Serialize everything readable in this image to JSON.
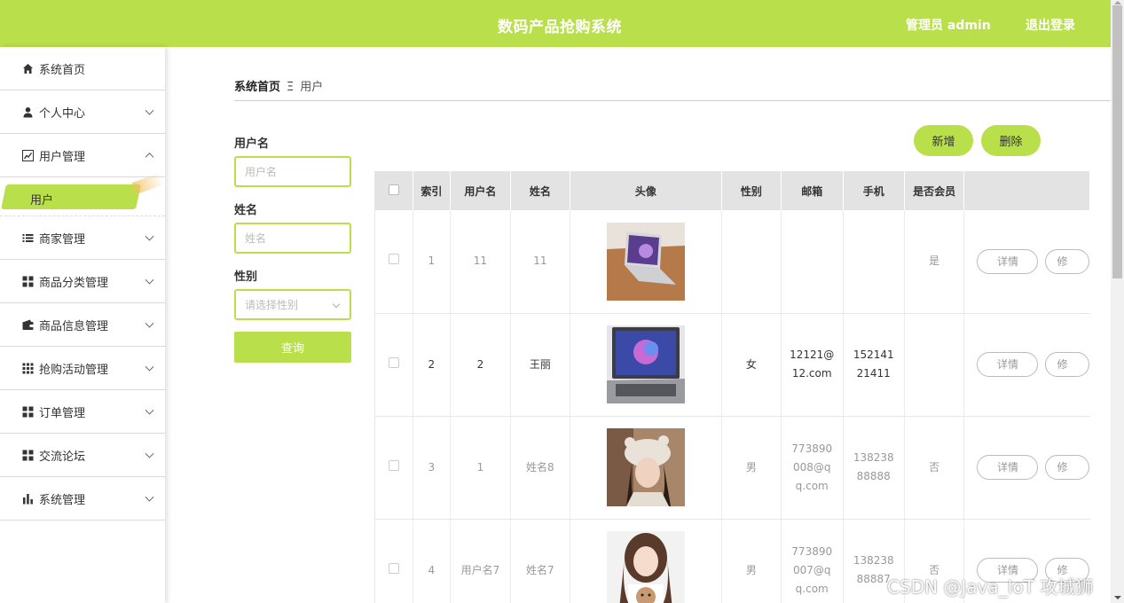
{
  "header": {
    "title": "数码产品抢购系统",
    "admin": "管理员 admin",
    "logout": "退出登录"
  },
  "sidebar": {
    "items": [
      {
        "label": "系统首页",
        "icon": "home-icon"
      },
      {
        "label": "个人中心",
        "icon": "user-icon"
      },
      {
        "label": "用户管理",
        "icon": "chart-icon"
      },
      {
        "label": "商家管理",
        "icon": "list-icon"
      },
      {
        "label": "商品分类管理",
        "icon": "grid-icon"
      },
      {
        "label": "商品信息管理",
        "icon": "wallet-icon"
      },
      {
        "label": "抢购活动管理",
        "icon": "apps-icon"
      },
      {
        "label": "订单管理",
        "icon": "grid-icon"
      },
      {
        "label": "交流论坛",
        "icon": "grid-icon"
      },
      {
        "label": "系统管理",
        "icon": "bar-chart-icon"
      }
    ],
    "active_sub": "用户"
  },
  "breadcrumb": {
    "home": "系统首页",
    "separator": "Ξ",
    "current": "用户"
  },
  "search": {
    "username_label": "用户名",
    "username_placeholder": "用户名",
    "name_label": "姓名",
    "name_placeholder": "姓名",
    "gender_label": "性别",
    "gender_placeholder": "请选择性别",
    "query_button": "查询"
  },
  "toolbar": {
    "add": "新增",
    "delete": "删除"
  },
  "table": {
    "headers": [
      "索引",
      "用户名",
      "姓名",
      "头像",
      "性别",
      "邮箱",
      "手机",
      "是否会员"
    ],
    "rows": [
      {
        "index": "1",
        "username": "11",
        "name": "11",
        "avatar": "laptop-photo",
        "gender": "",
        "email": "",
        "phone": "",
        "member": "是"
      },
      {
        "index": "2",
        "username": "2",
        "name": "王丽",
        "avatar": "laptop-photo",
        "gender": "女",
        "email": "12121@12.com",
        "phone": "15214121411",
        "member": ""
      },
      {
        "index": "3",
        "username": "1",
        "name": "姓名8",
        "avatar": "portrait-photo",
        "gender": "男",
        "email": "773890008@qq.com",
        "phone": "13823888888",
        "member": "否"
      },
      {
        "index": "4",
        "username": "用户名7",
        "name": "姓名7",
        "avatar": "portrait-photo",
        "gender": "男",
        "email": "773890007@qq.com",
        "phone": "13823888887",
        "member": "否"
      }
    ],
    "detail_button": "详情",
    "edit_button": "修"
  },
  "watermark": "CSDN @Java_IoT 攻城狮",
  "colors": {
    "accent": "#b9e04b"
  }
}
